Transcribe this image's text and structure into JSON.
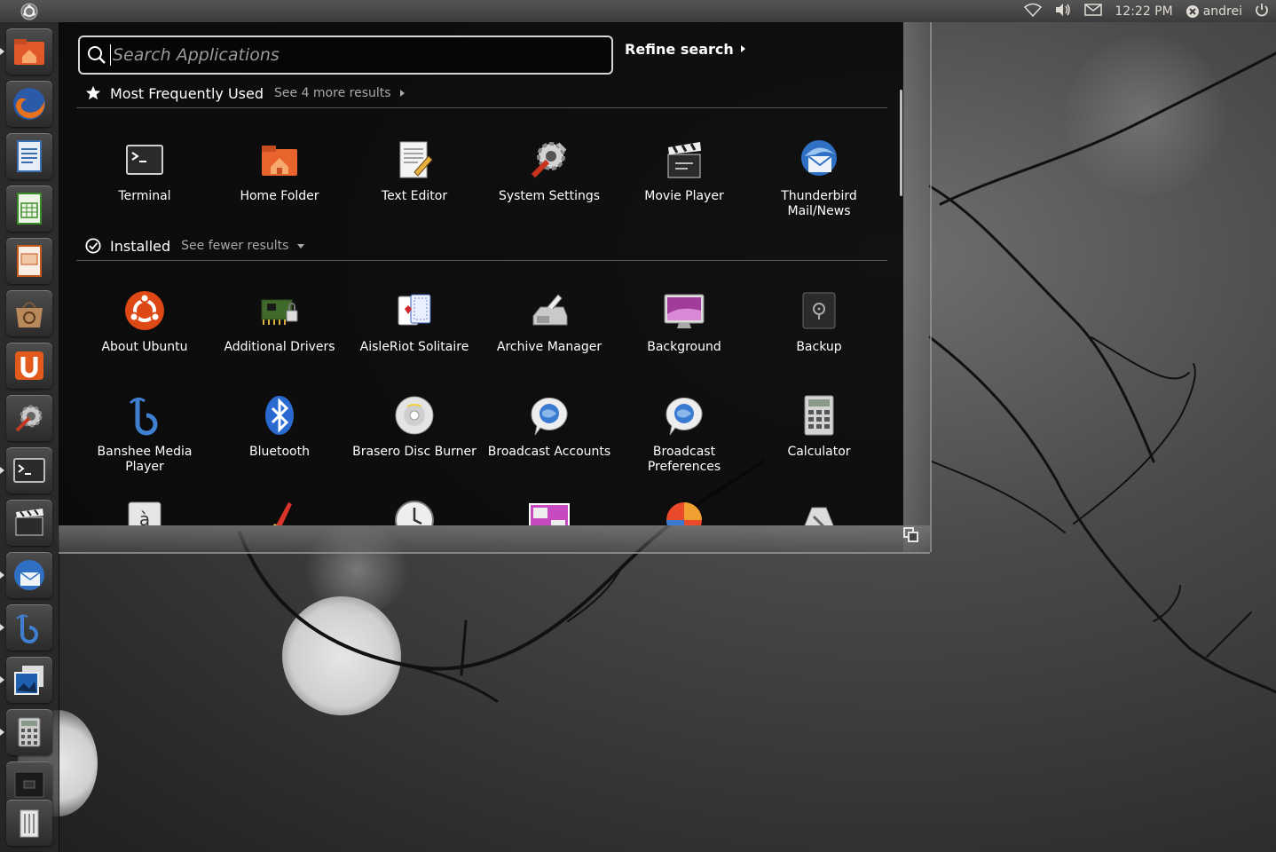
{
  "panel": {
    "clock": "12:22 PM",
    "user": "andrei",
    "indicators": [
      "wifi-icon",
      "volume-icon",
      "mail-icon",
      "user-icon",
      "power-icon"
    ]
  },
  "launcher": {
    "items": [
      "home-folder-icon",
      "firefox-icon",
      "writer-icon",
      "calc-icon",
      "impress-icon",
      "software-center-icon",
      "ubuntu-one-icon",
      "system-settings-icon",
      "terminal-icon",
      "movie-player-icon",
      "thunderbird-icon",
      "banshee-icon",
      "shotwell-icon",
      "calculator-icon",
      "workspaces-icon",
      "trash-icon"
    ]
  },
  "dash": {
    "search_placeholder": "Search Applications",
    "refine_label": "Refine search",
    "categories": {
      "frequent": {
        "title": "Most Frequently Used",
        "more": "See 4 more results"
      },
      "installed": {
        "title": "Installed",
        "more": "See fewer results"
      }
    },
    "frequent_apps": [
      {
        "label": "Terminal",
        "icon": "terminal-icon"
      },
      {
        "label": "Home Folder",
        "icon": "home-folder-icon"
      },
      {
        "label": "Text Editor",
        "icon": "text-editor-icon"
      },
      {
        "label": "System Settings",
        "icon": "system-settings-icon"
      },
      {
        "label": "Movie Player",
        "icon": "movie-player-icon"
      },
      {
        "label": "Thunderbird Mail/News",
        "icon": "thunderbird-icon"
      }
    ],
    "installed_apps": [
      {
        "label": "About Ubuntu",
        "icon": "ubuntu-logo-icon"
      },
      {
        "label": "Additional Drivers",
        "icon": "drivers-icon"
      },
      {
        "label": "AisleRiot Solitaire",
        "icon": "cards-icon"
      },
      {
        "label": "Archive Manager",
        "icon": "archive-icon"
      },
      {
        "label": "Background",
        "icon": "background-icon"
      },
      {
        "label": "Backup",
        "icon": "backup-icon"
      },
      {
        "label": "Banshee Media Player",
        "icon": "banshee-icon"
      },
      {
        "label": "Bluetooth",
        "icon": "bluetooth-icon"
      },
      {
        "label": "Brasero Disc Burner",
        "icon": "brasero-icon"
      },
      {
        "label": "Broadcast Accounts",
        "icon": "broadcast-accounts-icon"
      },
      {
        "label": "Broadcast Preferences",
        "icon": "broadcast-preferences-icon"
      },
      {
        "label": "Calculator",
        "icon": "calculator-icon"
      }
    ],
    "partial_row_icons": [
      "character-map-icon",
      "cleaner-icon",
      "clock-icon",
      "workspace-icon",
      "color-icon",
      "tools-icon"
    ]
  },
  "colors": {
    "panel": "#3c3c3c",
    "dash_bg": "#080808",
    "home_orange": "#e1582a",
    "ubuntu_orange": "#dd4814"
  }
}
